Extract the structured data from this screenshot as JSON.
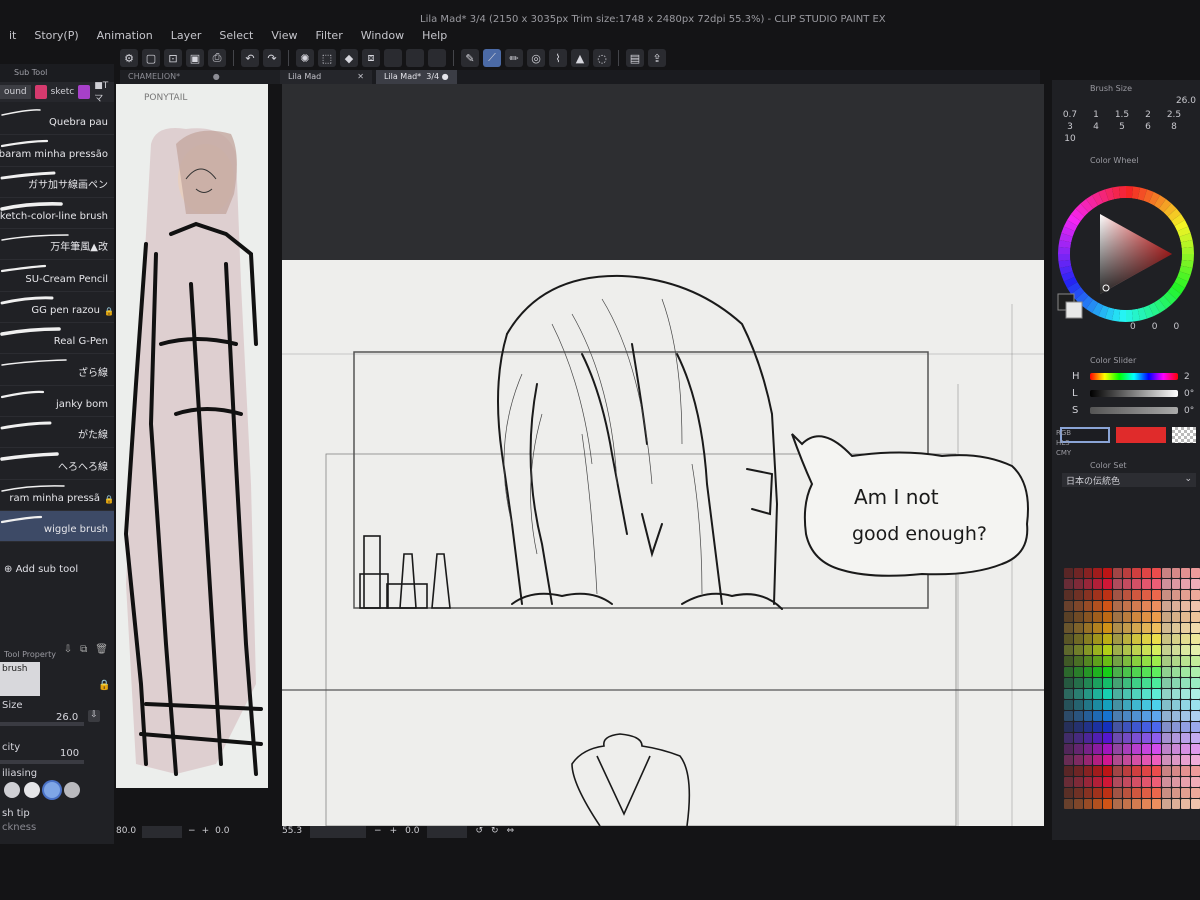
{
  "window_title": "Lila Mad* 3/4 (2150 x 3035px Trim size:1748 x 2480px 72dpi 55.3%) - CLIP STUDIO PAINT EX",
  "menu": [
    "it",
    "Story(P)",
    "Animation",
    "Layer",
    "Select",
    "View",
    "Filter",
    "Window",
    "Help"
  ],
  "toolbar_icons": [
    "gear-icon",
    "new-file-icon",
    "open-icon",
    "save-icon",
    "print-icon",
    "undo-icon",
    "redo-icon",
    "snap-icon",
    "transform-icon",
    "fill-icon",
    "crop-icon",
    "blank-icon",
    "blank-icon",
    "blank-icon",
    "pen-icon",
    "brush-icon",
    "pencil-icon",
    "target-icon",
    "eyedropper-icon",
    "marker-icon",
    "lasso-icon",
    "page-icon",
    "export-icon"
  ],
  "sub_tool": {
    "title": "Sub Tool",
    "tabs": [
      "ound",
      "sketc",
      "■Tマ"
    ],
    "brushes": [
      {
        "label": "Quebra pau",
        "locked": false
      },
      {
        "label": "ubaram minha pressão",
        "locked": false
      },
      {
        "label": "ガサ加サ線画ペン",
        "locked": false
      },
      {
        "label": "Sketch-color-line brush",
        "locked": false
      },
      {
        "label": "万年筆風▲改",
        "locked": false
      },
      {
        "label": "SU-Cream Pencil",
        "locked": false
      },
      {
        "label": "GG pen razou",
        "locked": true
      },
      {
        "label": "Real G-Pen",
        "locked": false
      },
      {
        "label": "ざら線",
        "locked": false
      },
      {
        "label": "janky bom",
        "locked": false
      },
      {
        "label": "がた線",
        "locked": false
      },
      {
        "label": "へろへろ線",
        "locked": false
      },
      {
        "label": "ram minha pressã",
        "locked": true
      },
      {
        "label": "wiggle brush",
        "locked": false
      }
    ],
    "selected_index": 13,
    "add_label": "Add sub tool"
  },
  "tool_property": {
    "title": "Tool Property",
    "brush_name": "brush",
    "size_label": "Size",
    "size_value": "26.0",
    "opacity_label": "city",
    "opacity_value": "100",
    "aa_label": "iliasing",
    "brush_tip_label": "sh tip",
    "thickness_label": "ckness"
  },
  "reference": {
    "tab_label": "CHAMELION*",
    "sketch_note": "PONYTAIL",
    "zoom_value": "80.0",
    "rotation_value": "0.0"
  },
  "document": {
    "tabs": [
      {
        "label": "Lila Mad",
        "active": false
      },
      {
        "label": "Lila Mad*",
        "counter": "3/4",
        "active": true
      }
    ],
    "zoom_value": "55.3",
    "rotation_value": "0.0",
    "speech_line1": "Am I not",
    "speech_line2": "good enough?"
  },
  "brush_size_panel": {
    "title": "Brush Size",
    "current": "26.0",
    "presets": [
      "0.7",
      "1",
      "1.5",
      "2",
      "2.5",
      "3",
      "4",
      "5",
      "6",
      "8",
      "10"
    ]
  },
  "color_wheel": {
    "title": "Color Wheel",
    "readout": [
      "0",
      "0",
      "0"
    ],
    "main_color": "#1e1e1e",
    "sub_color": "#e8e8e8"
  },
  "color_slider": {
    "title": "Color Slider",
    "modes": [
      "RGB",
      "HLS",
      "CMY"
    ],
    "rows": [
      {
        "label": "H",
        "value": "2"
      },
      {
        "label": "L",
        "value": "0°"
      },
      {
        "label": "S",
        "value": "0°"
      }
    ]
  },
  "color_set": {
    "title": "Color Set",
    "set_name": "日本の伝統色"
  },
  "colors": {
    "accent_red": "#e02b2b",
    "selected_row": "#3d4a66",
    "panel_bg": "#202125",
    "paper": "#eeeeec"
  }
}
